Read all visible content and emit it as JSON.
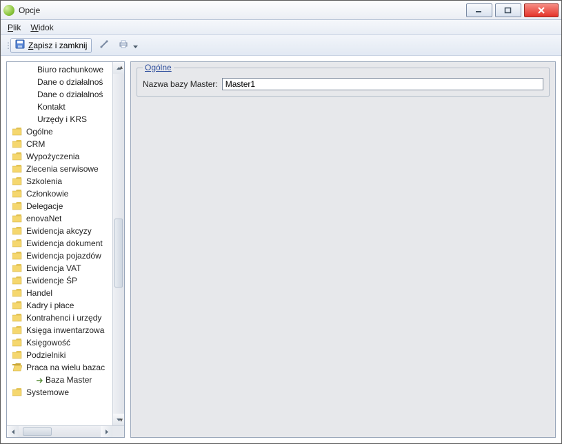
{
  "window": {
    "title": "Opcje"
  },
  "menubar": {
    "file": {
      "label": "Plik",
      "accel": "P"
    },
    "view": {
      "label": "Widok",
      "accel": "W"
    }
  },
  "toolbar": {
    "save_close": "Zapisz i zamknij",
    "accel": "Z"
  },
  "tree": {
    "recent_children": [
      "Biuro rachunkowe",
      "Dane o działalnoś",
      "Dane o działalnoś",
      "Kontakt",
      "Urzędy i KRS"
    ],
    "folders": [
      "Ogólne",
      "CRM",
      "Wypożyczenia",
      "Zlecenia serwisowe",
      "Szkolenia",
      "Członkowie",
      "Delegacje",
      "enovaNet",
      "Ewidencja akcyzy",
      "Ewidencja dokument",
      "Ewidencja pojazdów",
      "Ewidencja VAT",
      "Ewidencje ŚP",
      "Handel",
      "Kadry i płace",
      "Kontrahenci i urzędy",
      "Księga inwentarzowa",
      "Księgowość",
      "Podzielniki"
    ],
    "open_folder": "Praca na wielu bazac",
    "open_child": "Baza Master",
    "last_folder": "Systemowe"
  },
  "form": {
    "group_title": "Ogólne",
    "master_label": "Nazwa bazy Master:",
    "master_value": "Master1"
  }
}
